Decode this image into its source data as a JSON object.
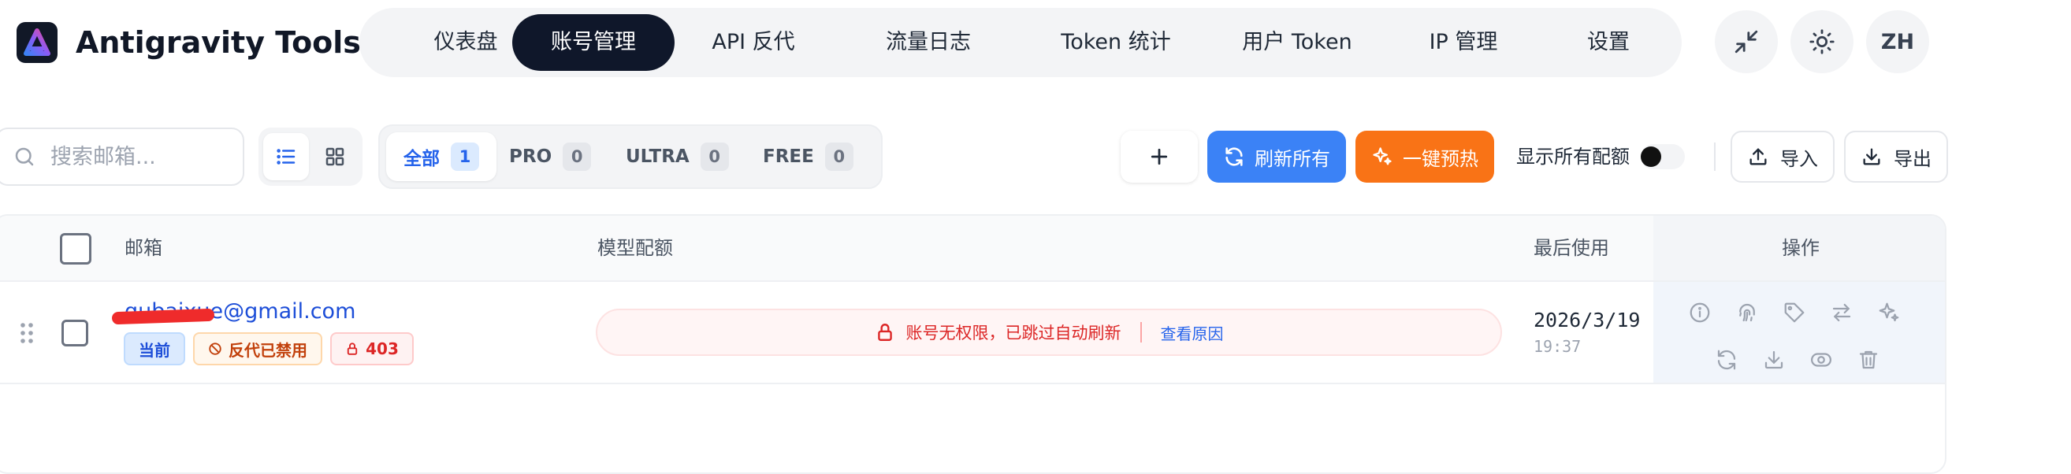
{
  "app": {
    "title": "Antigravity Tools",
    "logo_icon": "antigravity-logo-icon"
  },
  "nav": {
    "tabs": [
      {
        "label": "仪表盘",
        "active": false
      },
      {
        "label": "账号管理",
        "active": true
      },
      {
        "label": "API 反代",
        "active": false
      },
      {
        "label": "流量日志",
        "active": false
      },
      {
        "label": "Token 统计",
        "active": false
      },
      {
        "label": "用户 Token",
        "active": false
      },
      {
        "label": "IP 管理",
        "active": false
      },
      {
        "label": "设置",
        "active": false
      }
    ],
    "actions": {
      "collapse_icon": "minimize-icon",
      "theme_icon": "sun-icon",
      "language": "ZH"
    }
  },
  "toolbar": {
    "search": {
      "placeholder": "搜索邮箱...",
      "value": ""
    },
    "view_modes": [
      {
        "icon": "list-icon",
        "active": true
      },
      {
        "icon": "grid-icon",
        "active": false
      }
    ],
    "filters": [
      {
        "label": "全部",
        "count": "1",
        "active": true
      },
      {
        "label": "PRO",
        "count": "0",
        "active": false
      },
      {
        "label": "ULTRA",
        "count": "0",
        "active": false
      },
      {
        "label": "FREE",
        "count": "0",
        "active": false
      }
    ],
    "add_icon": "plus-icon",
    "refresh_all_label": "刷新所有",
    "warmup_label": "一键预热",
    "show_all_quota_label": "显示所有配额",
    "show_all_quota_enabled": false,
    "import_label": "导入",
    "export_label": "导出",
    "colors": {
      "primary": "#3b82f6",
      "warm": "#f97316",
      "nav_active": "#0f172a"
    }
  },
  "table": {
    "headers": {
      "email": "邮箱",
      "quota": "模型配额",
      "last_used": "最后使用",
      "actions": "操作"
    },
    "rows": [
      {
        "email": "qubaixue@gmail.com",
        "badges": {
          "current": "当前",
          "proxy_disabled": "反代已禁用",
          "status": "403"
        },
        "quota_message": "账号无权限，已跳过自动刷新",
        "quota_link": "查看原因",
        "last_used_date": "2026/3/19",
        "last_used_time": "19:37",
        "action_icons": [
          "info-icon",
          "fingerprint-icon",
          "tag-icon",
          "switch-icon",
          "sparkles-icon",
          "refresh-icon",
          "download-icon",
          "eye-icon",
          "trash-icon"
        ]
      }
    ]
  }
}
